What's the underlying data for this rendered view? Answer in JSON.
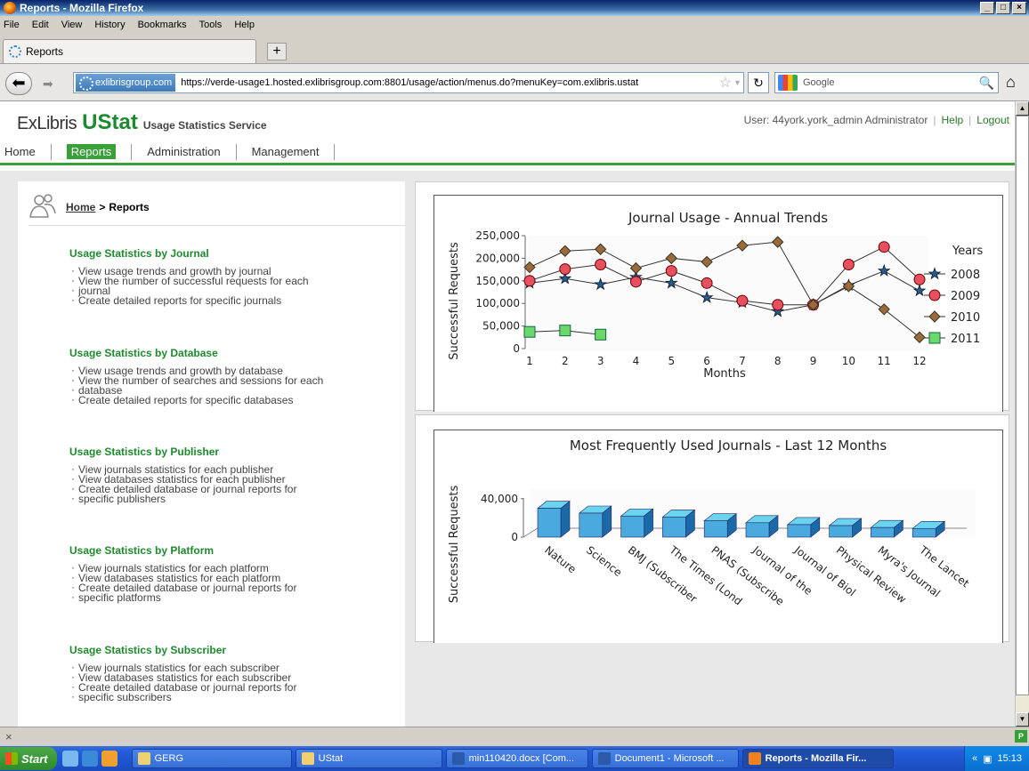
{
  "window": {
    "title": "Reports - Mozilla Firefox",
    "min": "_",
    "max": "□",
    "close": "×"
  },
  "menu": [
    "File",
    "Edit",
    "View",
    "History",
    "Bookmarks",
    "Tools",
    "Help"
  ],
  "tab": {
    "label": "Reports",
    "new_tab": "+"
  },
  "nav": {
    "site_badge": "exlibrisgroup.com",
    "url": "https://verde-usage1.hosted.exlibrisgroup.com:8801/usage/action/menus.do?menuKey=com.exlibris.ustat",
    "search_placeholder": "Google"
  },
  "header": {
    "logo_ex": "ExLibris",
    "logo_ustat": "UStat",
    "service": "Usage Statistics Service",
    "user": "User: 44york.york_admin Administrator",
    "help": "Help",
    "logout": "Logout"
  },
  "topnav": [
    "Home",
    "Reports",
    "Administration",
    "Management"
  ],
  "breadcrumb": {
    "home": "Home",
    "sep": ">",
    "current": "Reports"
  },
  "sections": [
    {
      "title": "Usage Statistics by Journal",
      "items": [
        "View usage trends and growth by journal",
        "View the number of successful requests for each",
        "journal",
        "Create detailed reports for specific journals"
      ]
    },
    {
      "title": "Usage Statistics by Database",
      "items": [
        "View usage trends and growth by database",
        "View the number of searches and sessions for each",
        "database",
        "Create detailed reports for specific databases"
      ]
    },
    {
      "title": "Usage Statistics by Publisher",
      "items": [
        "View journals statistics for each publisher",
        "View databases statistics for each publisher",
        "Create detailed database or journal reports for",
        "specific publishers"
      ]
    },
    {
      "title": "Usage Statistics by Platform",
      "items": [
        "View journals statistics for each platform",
        "View databases statistics for each platform",
        "Create detailed database or journal reports for",
        "specific platforms"
      ]
    },
    {
      "title": "Usage Statistics by Subscriber",
      "items": [
        "View journals statistics for each subscriber",
        "View databases statistics for each subscriber",
        "Create detailed database or journal reports for",
        "specific subscribers"
      ]
    }
  ],
  "chart_data": [
    {
      "type": "line",
      "title": "Journal Usage - Annual Trends",
      "xlabel": "Months",
      "ylabel": "Successful Requests",
      "x": [
        1,
        2,
        3,
        4,
        5,
        6,
        7,
        8,
        9,
        10,
        11,
        12
      ],
      "ylim": [
        0,
        250000
      ],
      "yticks": [
        "0",
        "50,000",
        "100,000",
        "150,000",
        "200,000",
        "250,000"
      ],
      "legend_title": "Years",
      "legend_position": "right",
      "series": [
        {
          "name": "2008",
          "color": "#1a3a5a",
          "marker": "star",
          "values": [
            145000,
            155000,
            142000,
            158000,
            145000,
            113000,
            102000,
            82000,
            97000,
            140000,
            172000,
            128000
          ]
        },
        {
          "name": "2009",
          "color": "#d03040",
          "marker": "circle",
          "values": [
            150000,
            176000,
            186000,
            148000,
            172000,
            145000,
            106000,
            97000,
            97000,
            186000,
            225000,
            153000
          ]
        },
        {
          "name": "2010",
          "color": "#7a5a2a",
          "marker": "diamond",
          "values": [
            180000,
            216000,
            220000,
            178000,
            200000,
            192000,
            228000,
            236000,
            97000,
            138000,
            87000,
            25000
          ]
        },
        {
          "name": "2011",
          "color": "#3aa03a",
          "marker": "square",
          "values": [
            37000,
            40000,
            31000,
            null,
            null,
            null,
            null,
            null,
            null,
            null,
            null,
            null
          ]
        }
      ]
    },
    {
      "type": "bar",
      "title": "Most Frequently Used Journals - Last 12 Months",
      "ylabel": "Successful Requests",
      "ylim": [
        0,
        50000
      ],
      "yticks": [
        "0",
        "40,000"
      ],
      "categories": [
        "Nature",
        "Science",
        "BMJ (Subscriber",
        "The Times (Lond",
        "PNAS (Subscribe",
        "Journal of the",
        "Journal of Biol",
        "Physical Review",
        "Myra's Journal",
        "The Lancet"
      ],
      "values": [
        30000,
        25000,
        22000,
        21000,
        17000,
        15000,
        13000,
        12000,
        10000,
        9000
      ],
      "color": "#4aaadd"
    }
  ],
  "status": {
    "close": "×"
  },
  "taskbar": {
    "start": "Start",
    "buttons": [
      "GERG",
      "UStat",
      "min110420.docx [Com...",
      "Document1 - Microsoft ...",
      "Reports - Mozilla Fir..."
    ],
    "clock": "15:13"
  }
}
